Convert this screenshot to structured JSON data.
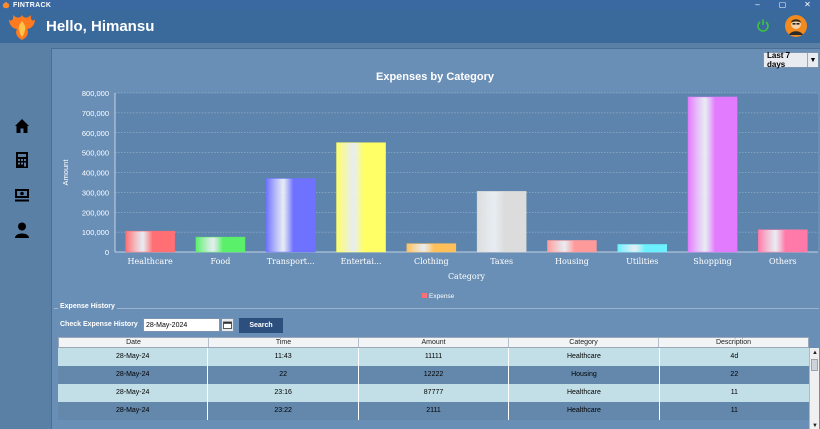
{
  "window": {
    "title": "FINTRACK",
    "controls": [
      "–",
      "▢",
      "✕"
    ]
  },
  "header": {
    "greeting": "Hello, Himansu"
  },
  "sidebar": {
    "items": [
      "home-icon",
      "calculator-icon",
      "cash-icon",
      "user-icon"
    ]
  },
  "filter": {
    "range_value": "Last 7 days"
  },
  "chart_data": {
    "type": "bar",
    "title": "Expenses by Category",
    "xlabel": "Category",
    "ylabel": "Amount",
    "categories": [
      "Healthcare",
      "Food",
      "Transport...",
      "Entertai...",
      "Clothing",
      "Taxes",
      "Housing",
      "Utilities",
      "Shopping",
      "Others"
    ],
    "series": [
      {
        "name": "Expense",
        "values": [
          105000,
          75000,
          370000,
          550000,
          42000,
          305000,
          58000,
          38000,
          780000,
          112000
        ]
      }
    ],
    "colors": [
      "#ff6f73",
      "#5af06a",
      "#6e72ff",
      "#ffff66",
      "#ffc05a",
      "#dcdcdc",
      "#ff9a9a",
      "#6cf0ff",
      "#e37bff",
      "#ff7aa8"
    ],
    "yticks": [
      "0",
      "100,000",
      "200,000",
      "300,000",
      "400,000",
      "500,000",
      "600,000",
      "700,000",
      "800,000"
    ],
    "ylim": [
      0,
      800000
    ],
    "legend": "bottom-center",
    "grid": true
  },
  "history": {
    "section_title": "Expense History",
    "check_label": "Check Expense History",
    "date_value": "28-May-2024",
    "search_label": "Search",
    "columns": [
      "Date",
      "Time",
      "Amount",
      "Category",
      "Description"
    ],
    "rows": [
      [
        "28-May-24",
        "11:43",
        "11111",
        "Healthcare",
        "4d"
      ],
      [
        "28-May-24",
        "22",
        "12222",
        "Housing",
        "22"
      ],
      [
        "28-May-24",
        "23:16",
        "87777",
        "Healthcare",
        "11"
      ],
      [
        "28-May-24",
        "23:22",
        "2111",
        "Healthcare",
        "11"
      ]
    ]
  }
}
